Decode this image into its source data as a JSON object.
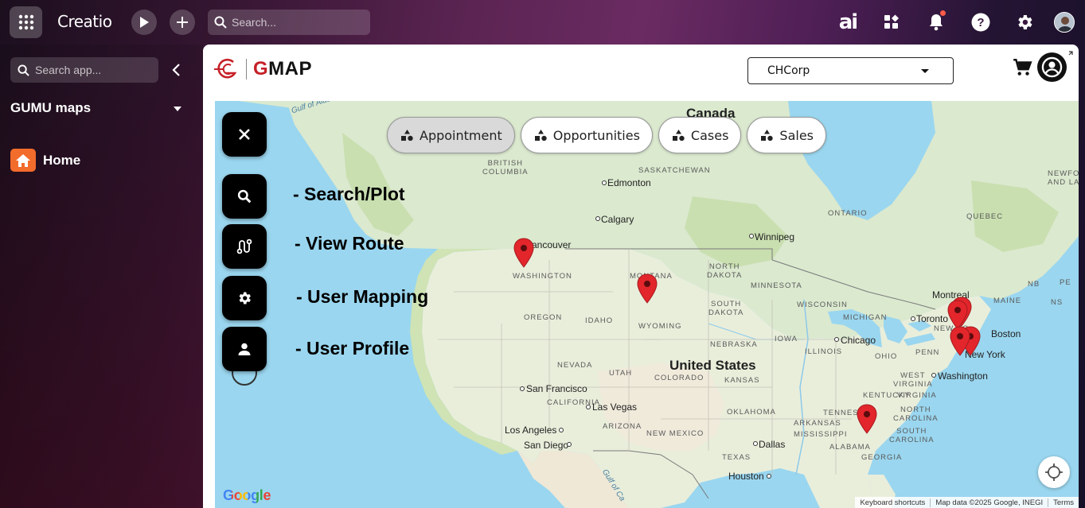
{
  "topbar": {
    "logo": "Creatio",
    "search_placeholder": "Search...",
    "ai_label": "ai"
  },
  "sidebar": {
    "search_placeholder": "Search app...",
    "section_title": "GUMU maps",
    "items": [
      {
        "label": "Home"
      }
    ]
  },
  "app": {
    "brand_g": "G",
    "brand_rest": "MAP",
    "org_select_value": "CHCorp"
  },
  "map": {
    "chips": [
      {
        "label": "Appointment",
        "active": true
      },
      {
        "label": "Opportunities",
        "active": false
      },
      {
        "label": "Cases",
        "active": false
      },
      {
        "label": "Sales",
        "active": false
      }
    ],
    "menu": [
      {
        "label": "- Search/Plot",
        "icon": "search-icon"
      },
      {
        "label": "- View Route",
        "icon": "route-icon"
      },
      {
        "label": "- User Mapping",
        "icon": "gear-icon"
      },
      {
        "label": "- User Profile",
        "icon": "person-icon"
      }
    ],
    "labels": {
      "canada": "Canada",
      "us": "United States",
      "british_columbia": "BRITISH\nCOLUMBIA",
      "saskatchewan": "SASKATCHEWAN",
      "ontario": "ONTARIO",
      "quebec": "QUEBEC",
      "newfoundland": "NEWFOU\nAND LAB",
      "edmonton": "Edmonton",
      "calgary": "Calgary",
      "winnipeg": "Winnipeg",
      "vancouver": "ancouver",
      "washington": "WASHINGTON",
      "montana": "MONTANA",
      "north_dakota": "NORTH\nDAKOTA",
      "minnesota": "MINNESOTA",
      "south_dakota": "SOUTH\nDAKOTA",
      "wisconsin": "WISCONSIN",
      "michigan": "MICHIGAN",
      "oregon": "OREGON",
      "idaho": "IDAHO",
      "wyoming": "WYOMING",
      "iowa": "IOWA",
      "nebraska": "NEBRASKA",
      "illinois": "ILLINOIS",
      "ohio": "OHIO",
      "penn": "PENN",
      "nevada": "NEVADA",
      "utah": "UTAH",
      "colorado": "COLORADO",
      "kansas": "KANSAS",
      "california": "CALIFORNIA",
      "arizona": "ARIZONA",
      "new_mexico": "NEW MEXICO",
      "oklahoma": "OKLAHOMA",
      "texas": "TEXAS",
      "arkansas": "ARKANSAS",
      "mississippi": "MISSISSIPPI",
      "alabama": "ALABAMA",
      "georgia": "GEORGIA",
      "tennessee": "TENNESSE",
      "kentucky": "KENTUCKY",
      "west_virginia": "WEST\nVIRGINIA",
      "virginia": "VIRGINIA",
      "north_carolina": "NORTH\nCAROLINA",
      "south_carolina": "SOUTH\nCAROLINA",
      "maine": "MAINE",
      "nb": "NB",
      "pei": "PE",
      "ns": "NS",
      "new_york_state": "NEW YO",
      "montreal": "Montreal",
      "toronto": "Toronto",
      "boston": "Boston",
      "new_york": "New York",
      "washington_dc": "Washington",
      "chicago": "Chicago",
      "san_francisco": "San Francisco",
      "las_vegas": "Las Vegas",
      "los_angeles": "Los Angeles",
      "san_diego": "San Diego",
      "dallas": "Dallas",
      "houston": "Houston",
      "gulf_alaska": "Gulf of Alaska",
      "gulf_california": "Gulf of Ca",
      "google": "Google"
    },
    "attribution": {
      "shortcuts": "Keyboard shortcuts",
      "data": "Map data ©2025 Google, INEGI",
      "terms": "Terms"
    }
  },
  "colors": {
    "accent": "#c62027",
    "home_icon": "#f26c2c",
    "water": "#9ad6ef",
    "land": "#e8f0d8",
    "pin": "#e2262b"
  }
}
